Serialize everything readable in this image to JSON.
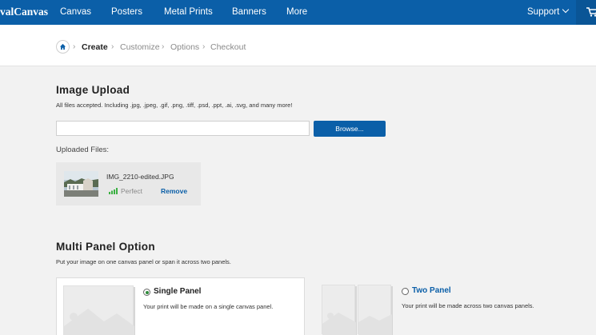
{
  "nav": {
    "logo": "valCanvas",
    "items": [
      "Canvas",
      "Posters",
      "Metal Prints",
      "Banners",
      "More"
    ],
    "support": "Support",
    "colors": {
      "bar": "#0b5fa8",
      "cart_bg": "#0a5596"
    }
  },
  "breadcrumb": {
    "steps": [
      "Create",
      "Customize",
      "Options",
      "Checkout"
    ],
    "active": "Create",
    "separator": "›"
  },
  "upload": {
    "title": "Image Upload",
    "subtitle": "All files accepted. Including .jpg, .jpeg, .gif, .png, .tiff, .psd, .ppt, .ai, .svg, and many more!",
    "input_value": "",
    "browse_label": "Browse...",
    "uploaded_label": "Uploaded Files:",
    "file": {
      "name": "IMG_2210-edited.JPG",
      "quality": "Perfect",
      "remove_label": "Remove"
    }
  },
  "multi_panel": {
    "title": "Multi Panel Option",
    "subtitle": "Put your image on one canvas panel or span it across two panels.",
    "options": [
      {
        "label": "Single Panel",
        "desc": "Your print will be made on a single canvas panel.",
        "selected": true
      },
      {
        "label": "Two Panel",
        "desc": "Your print will be made across two canvas panels.",
        "selected": false
      }
    ],
    "colors": {
      "selected_radio": "#2e8b3a",
      "link": "#0b5fa8"
    }
  }
}
